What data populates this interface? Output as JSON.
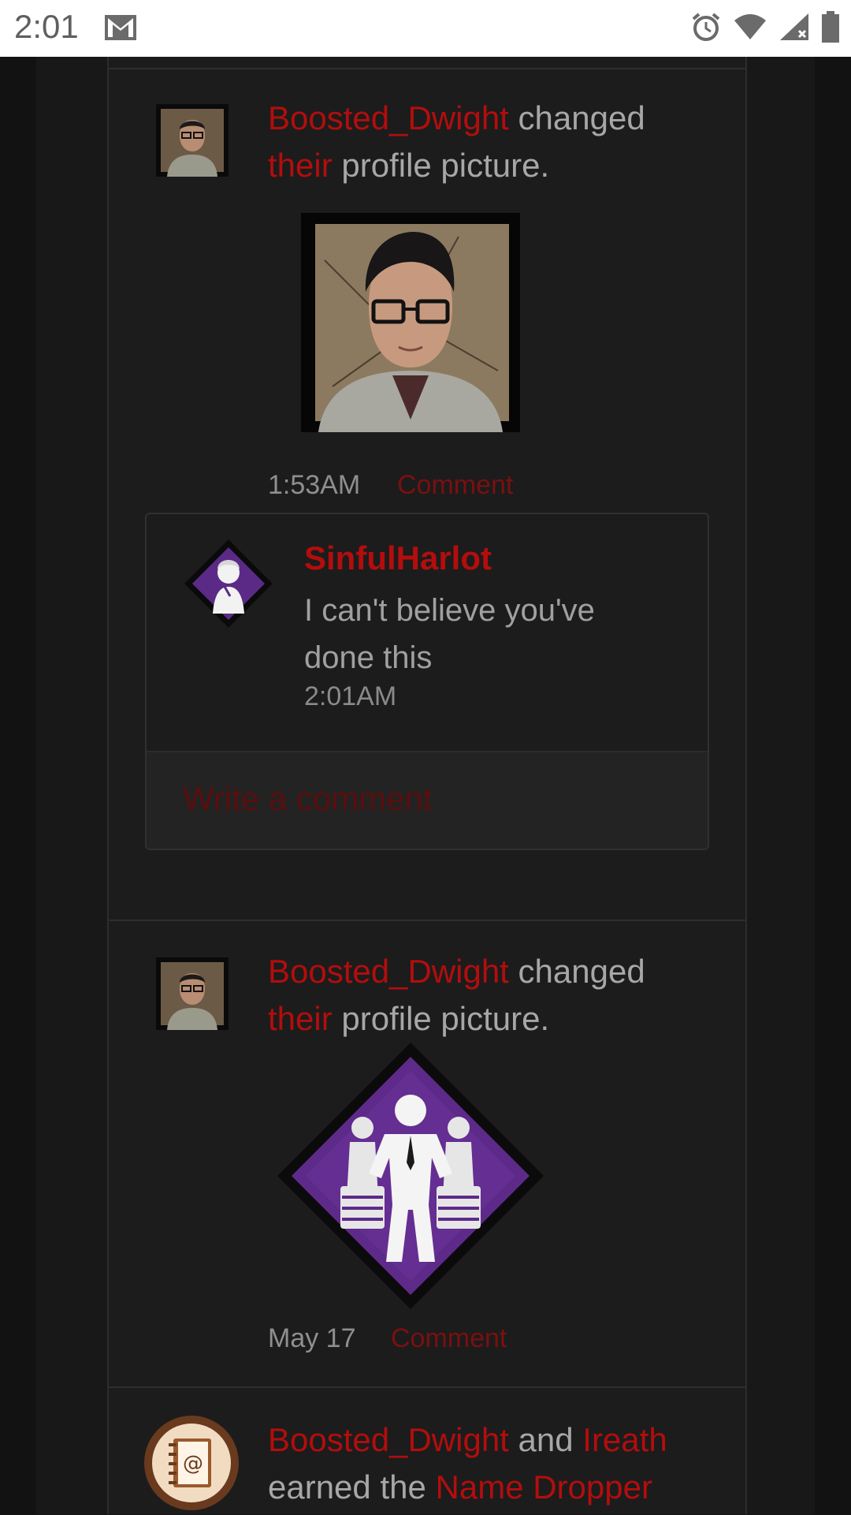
{
  "status_bar": {
    "time": "2:01",
    "icons": [
      "gmail-icon",
      "alarm-icon",
      "wifi-icon",
      "signal-icon",
      "battery-icon"
    ]
  },
  "feed": [
    {
      "actor": "Boosted_Dwight",
      "verb": " changed",
      "possessive": "their",
      "object": " profile picture.",
      "image": "dwight-portrait",
      "timestamp": "1:53AM",
      "comment_link": "Comment",
      "comments": [
        {
          "author": "SinfulHarlot",
          "text": "I can't believe you've done this",
          "time": "2:01AM"
        }
      ],
      "write_placeholder": "Write a comment"
    },
    {
      "actor": "Boosted_Dwight",
      "verb": " changed",
      "possessive": "their",
      "object": " profile picture.",
      "image": "leader-perk-badge",
      "timestamp": "May 17",
      "comment_link": "Comment"
    },
    {
      "actor": "Boosted_Dwight",
      "conjunction": " and ",
      "actor2": "Ireath",
      "line2_prefix": "earned the ",
      "badge_name": "Name Dropper",
      "icon": "address-book-icon"
    }
  ],
  "colors": {
    "accent": "#b30d0d",
    "background": "#141414",
    "card": "#1c1c1c",
    "text": "#a7a7a7"
  }
}
